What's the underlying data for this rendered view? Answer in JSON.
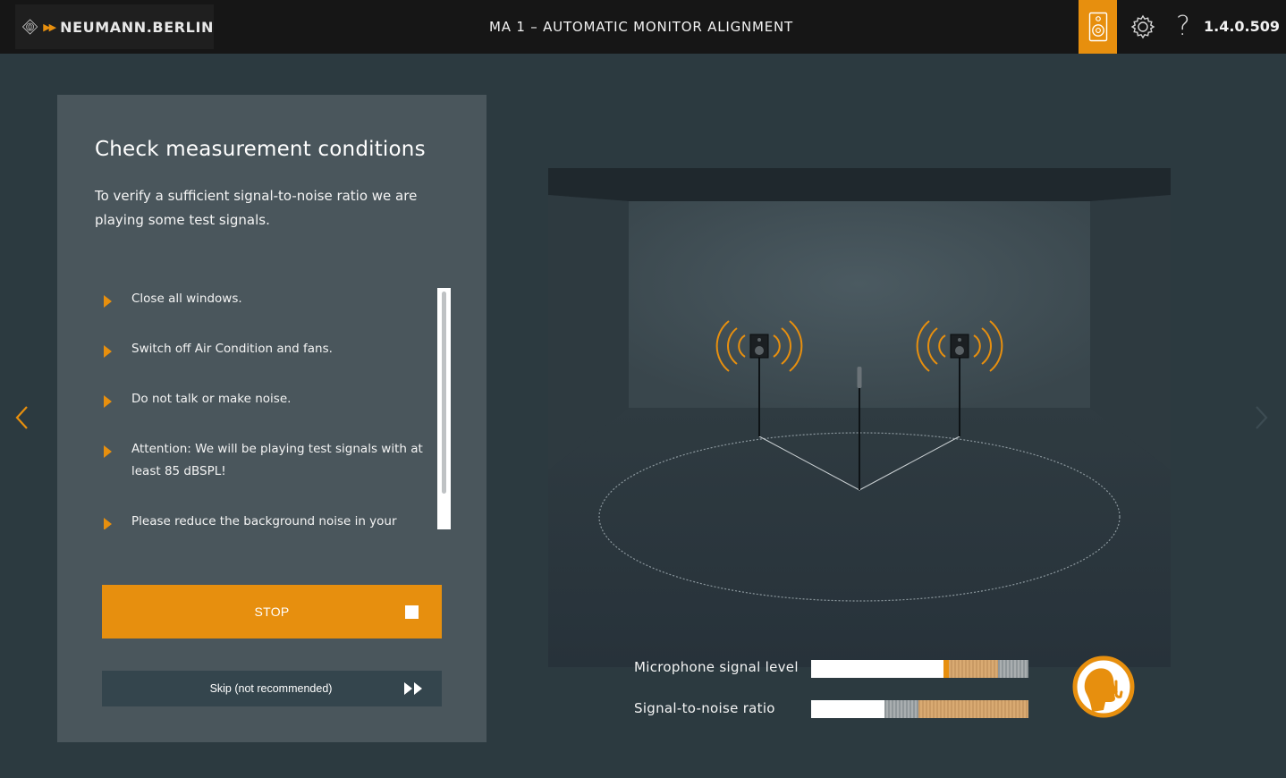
{
  "header": {
    "brand": "NEUMANN.BERLIN",
    "title": "MA 1 – AUTOMATIC MONITOR ALIGNMENT",
    "version": "1.4.0.509",
    "help_label": "?"
  },
  "panel": {
    "title": "Check measurement conditions",
    "intro": "To verify a sufficient signal-to-noise ratio we are playing some test signals.",
    "checklist": [
      {
        "text": "Close all windows."
      },
      {
        "text": "Switch off Air Condition and fans."
      },
      {
        "text": "Do not talk or make noise."
      },
      {
        "text": "Attention: We will be playing test signals with at least 85 dBSPL!"
      },
      {
        "text": "Please reduce the background noise in your"
      }
    ],
    "stop_label": "STOP",
    "skip_label": "Skip (not recommended)"
  },
  "meters": {
    "mic_label": "Microphone signal level",
    "snr_label": "Signal-to-noise ratio",
    "mic_level": 0.61,
    "snr_level": 0.34
  },
  "colors": {
    "accent": "#e78f0e",
    "background": "#2c3a40",
    "panel": "#4a565c",
    "topbar": "#161616"
  },
  "icons": {
    "speaker": "speaker-icon",
    "settings": "gear-icon",
    "help": "question-mark-icon",
    "quiet": "silence-gesture-icon"
  }
}
